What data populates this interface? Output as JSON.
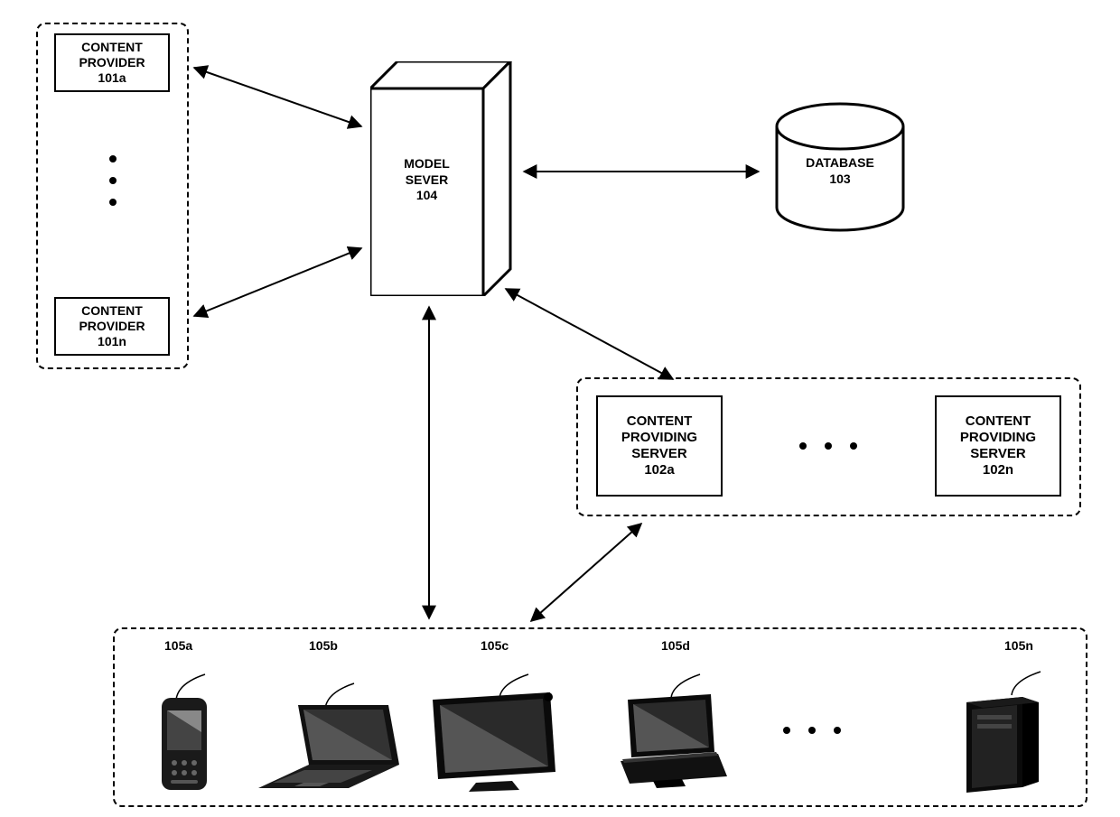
{
  "model_server": {
    "line1": "MODEL",
    "line2": "SEVER",
    "ref": "104"
  },
  "database": {
    "label": "DATABASE",
    "ref": "103"
  },
  "content_providers": {
    "a": {
      "line1": "CONTENT",
      "line2": "PROVIDER",
      "ref": "101a"
    },
    "n": {
      "line1": "CONTENT",
      "line2": "PROVIDER",
      "ref": "101n"
    }
  },
  "content_providing_servers": {
    "a": {
      "line1": "CONTENT",
      "line2": "PROVIDING",
      "line3": "SERVER",
      "ref": "102a"
    },
    "n": {
      "line1": "CONTENT",
      "line2": "PROVIDING",
      "line3": "SERVER",
      "ref": "102n"
    }
  },
  "devices": {
    "a": "105a",
    "b": "105b",
    "c": "105c",
    "d": "105d",
    "n": "105n"
  }
}
